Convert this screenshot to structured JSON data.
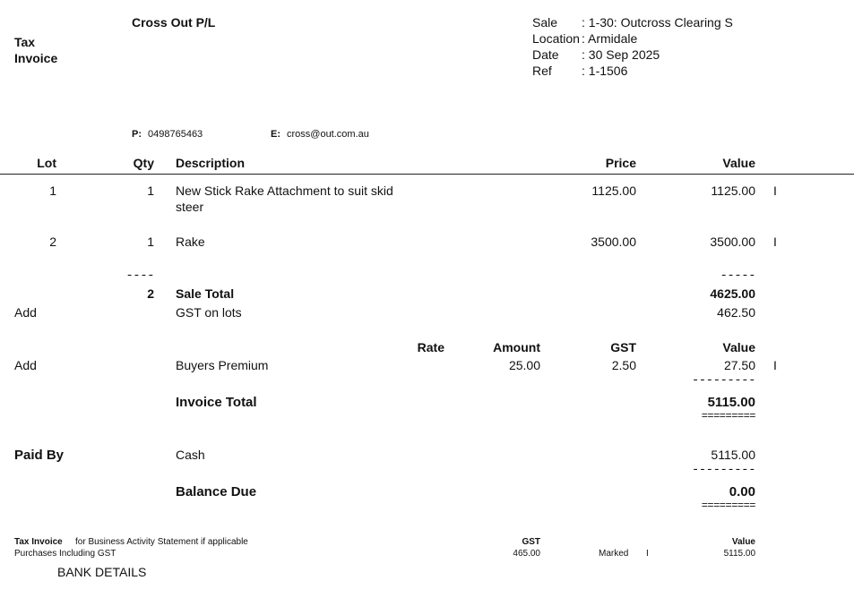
{
  "header": {
    "doc_type_line1": "Tax",
    "doc_type_line2": "Invoice",
    "seller": "Cross Out P/L",
    "meta": [
      {
        "label": "Sale",
        "value": ": 1-30: Outcross Clearing S"
      },
      {
        "label": "Location",
        "value": ": Armidale"
      },
      {
        "label": "Date",
        "value": ": 30 Sep 2025"
      },
      {
        "label": "Ref",
        "value": ": 1-1506"
      }
    ],
    "phone_label": "P:",
    "phone": "0498765463",
    "email_label": "E:",
    "email": "cross@out.com.au"
  },
  "table": {
    "columns": {
      "lot": "Lot",
      "qty": "Qty",
      "description": "Description",
      "price": "Price",
      "value": "Value"
    },
    "rows": [
      {
        "lot": "1",
        "qty": "1",
        "desc1": "New Stick Rake Attachment to suit skid",
        "desc2": "steer",
        "price": "1125.00",
        "value": "1125.00",
        "mark": "I"
      },
      {
        "lot": "2",
        "qty": "1",
        "desc1": "Rake",
        "desc2": "",
        "price": "3500.00",
        "value": "3500.00",
        "mark": "I"
      }
    ]
  },
  "summary": {
    "qty_dash": "----",
    "value_dash": "-----",
    "total_qty": "2",
    "sale_total_label": "Sale Total",
    "sale_total": "4625.00",
    "add_label": "Add",
    "gst_label": "GST on lots",
    "gst_value": "462.50"
  },
  "premium": {
    "rate_header": "Rate",
    "amount_header": "Amount",
    "gst_header": "GST",
    "value_header": "Value",
    "add_label": "Add",
    "label": "Buyers Premium",
    "amount": "25.00",
    "gst": "2.50",
    "value": "27.50",
    "mark": "I"
  },
  "invoice_total": {
    "dash": "---------",
    "label": "Invoice Total",
    "value": "5115.00",
    "double": "========="
  },
  "payment": {
    "label": "Paid By",
    "method": "Cash",
    "value": "5115.00",
    "dash": "---------",
    "balance_label": "Balance Due",
    "balance": "0.00",
    "double": "========="
  },
  "footer": {
    "tax_invoice_bold": "Tax Invoice",
    "tax_invoice_text": "for Business Activity Statement if applicable",
    "purchases_label": "Purchases Including GST",
    "gst_header": "GST",
    "gst_value": "465.00",
    "marked_label": "Marked",
    "marked_flag": "I",
    "value_header": "Value",
    "value": "5115.00",
    "bank_details": "BANK DETAILS"
  }
}
